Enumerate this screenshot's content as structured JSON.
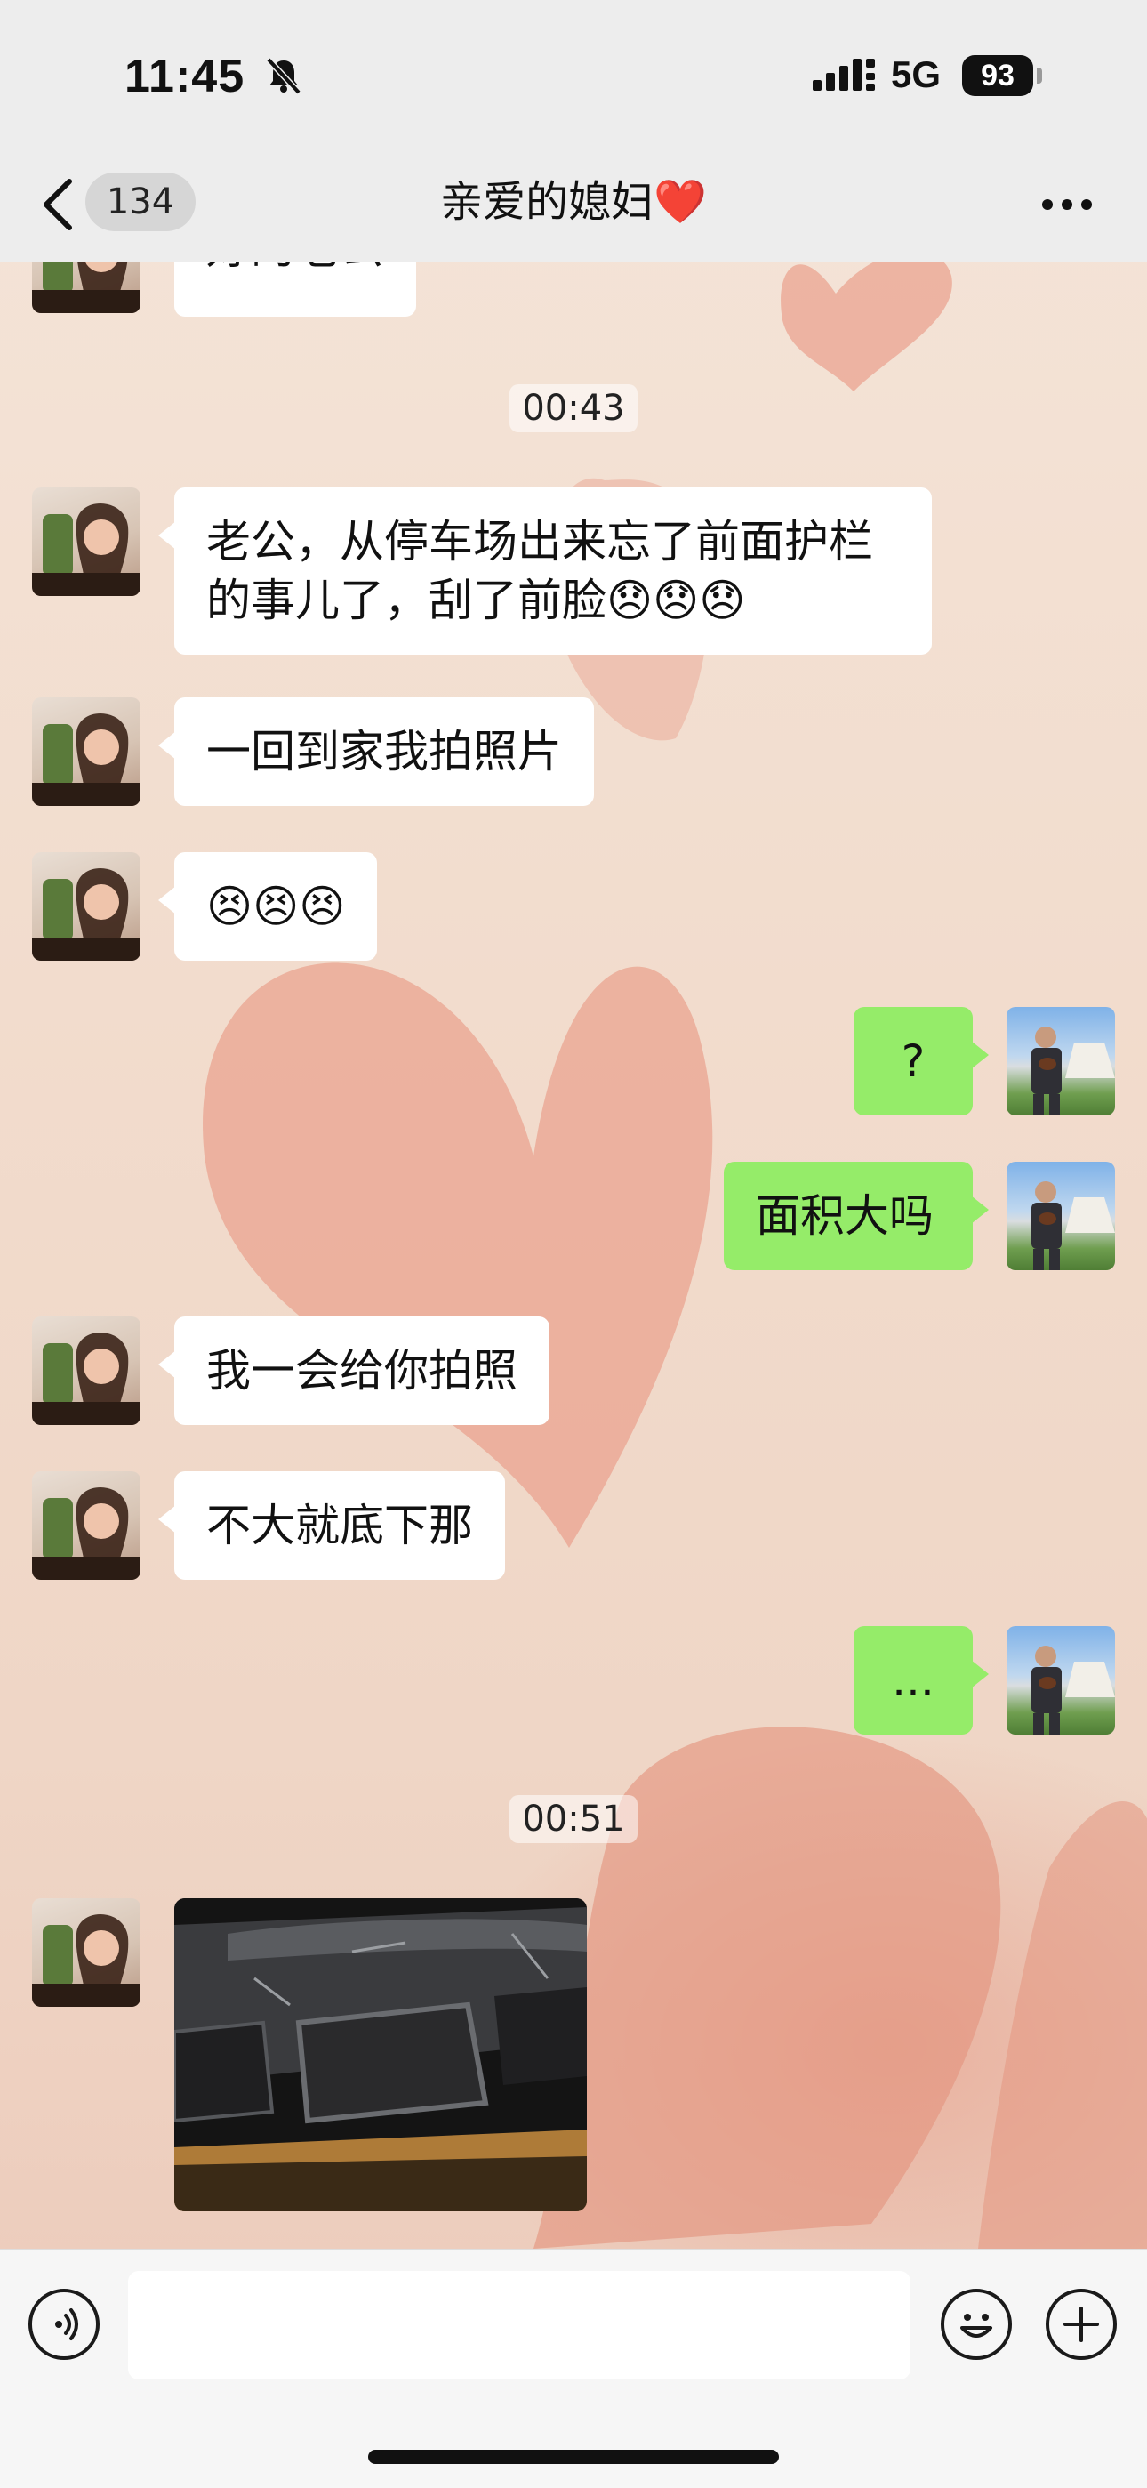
{
  "status_bar": {
    "time": "11:45",
    "network": "5G",
    "battery": "93"
  },
  "nav": {
    "unread_badge": "134",
    "chat_title": "亲爱的媳妇",
    "title_emoji": "❤️"
  },
  "messages": [
    {
      "sender": "her",
      "type": "text",
      "text": "好的老公"
    },
    {
      "type": "timestamp",
      "text": "00:43"
    },
    {
      "sender": "her",
      "type": "text",
      "line1": "老公，从停车场出来忘了前面护栏",
      "line2": "的事儿了，刮了前脸",
      "emoji": "😞😞😞"
    },
    {
      "sender": "her",
      "type": "text",
      "text": "一回到家我拍照片"
    },
    {
      "sender": "her",
      "type": "text",
      "emoji": "😣😣😣"
    },
    {
      "sender": "me",
      "type": "text",
      "text": "?"
    },
    {
      "sender": "me",
      "type": "text",
      "text": "面积大吗"
    },
    {
      "sender": "her",
      "type": "text",
      "text": "我一会给你拍照"
    },
    {
      "sender": "her",
      "type": "text",
      "text": "不大就底下那"
    },
    {
      "sender": "me",
      "type": "text",
      "text": "..."
    },
    {
      "type": "timestamp",
      "text": "00:51"
    },
    {
      "sender": "her",
      "type": "image",
      "depicts": "car front bumper scratch"
    }
  ],
  "input_bar": {
    "voice_icon": "voice-icon",
    "emoji_icon": "smile-icon",
    "plus_icon": "plus-icon",
    "placeholder": ""
  },
  "colors": {
    "bubble_me": "#95ec69",
    "bubble_her": "#ffffff",
    "bar_bg": "#ededed"
  }
}
